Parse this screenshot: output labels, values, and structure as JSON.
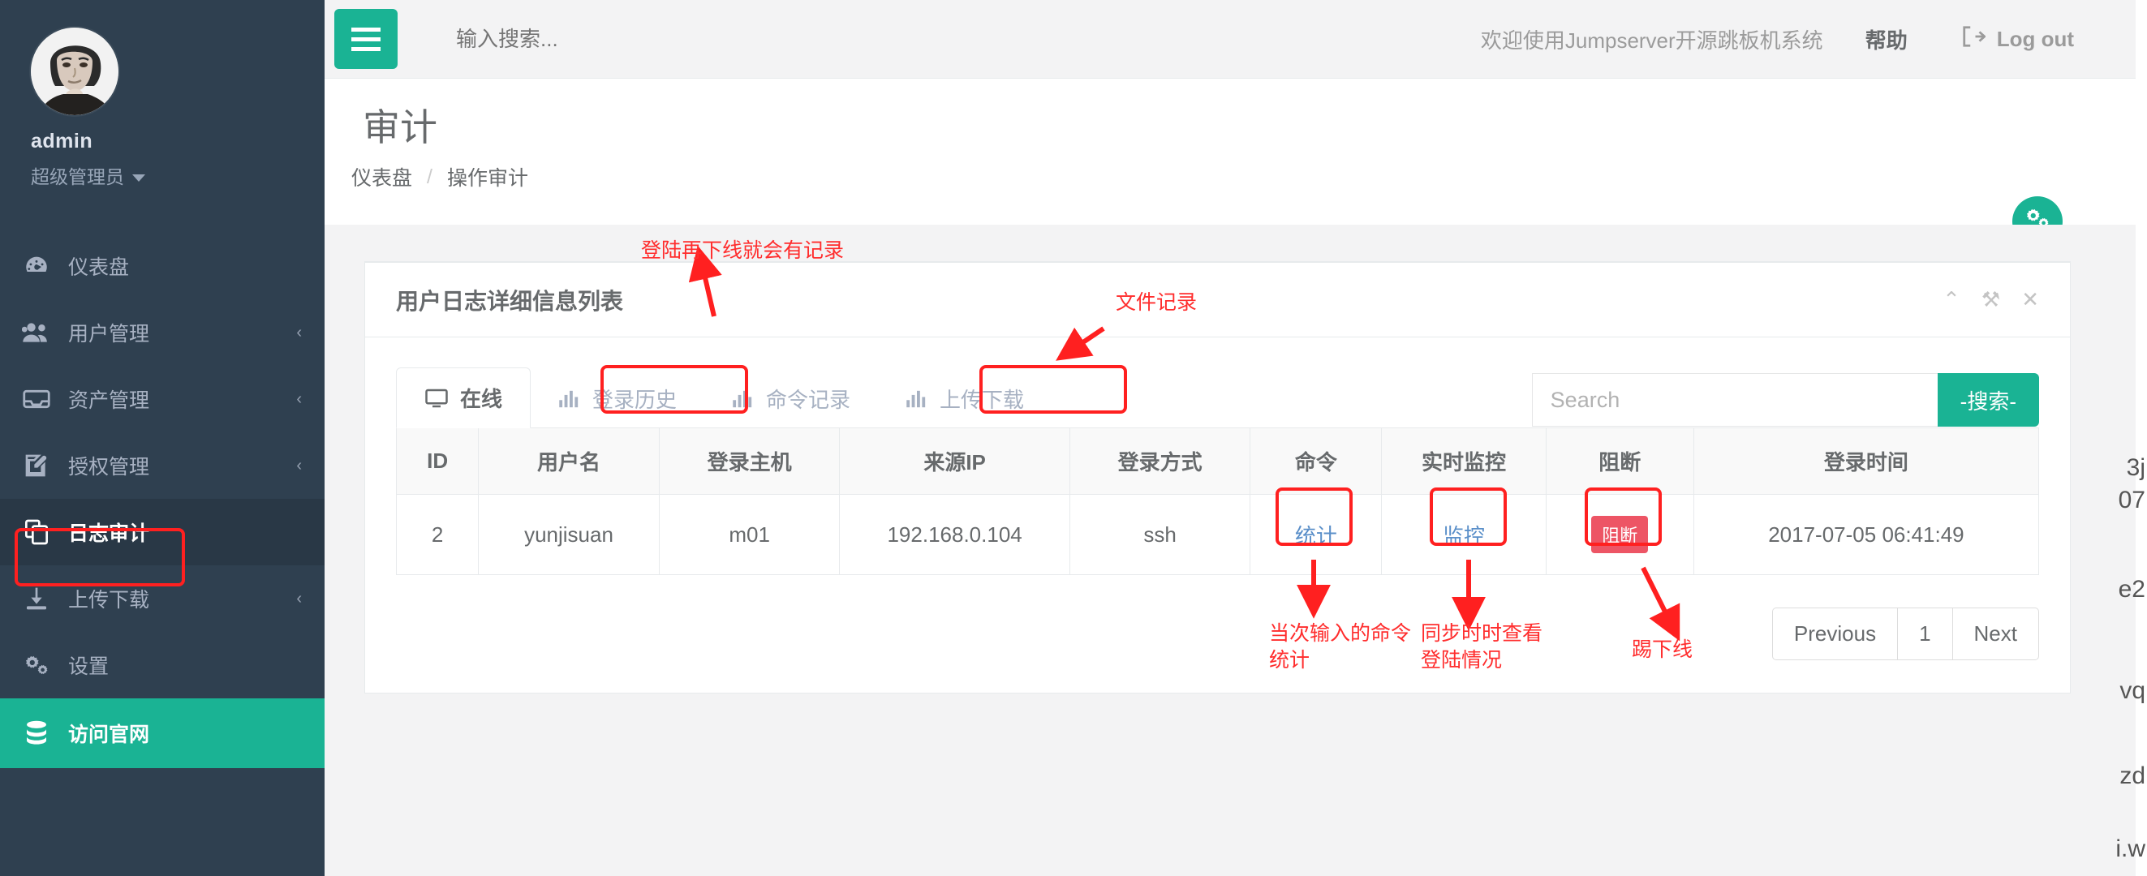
{
  "sidebar": {
    "user": {
      "name": "admin",
      "role": "超级管理员"
    },
    "items": [
      {
        "label": "仪表盘",
        "icon": "dashboard-icon",
        "arrow": "",
        "state": "normal"
      },
      {
        "label": "用户管理",
        "icon": "users-icon",
        "arrow": "‹",
        "state": "normal"
      },
      {
        "label": "资产管理",
        "icon": "inbox-icon",
        "arrow": "‹",
        "state": "normal"
      },
      {
        "label": "授权管理",
        "icon": "edit-icon",
        "arrow": "‹",
        "state": "normal"
      },
      {
        "label": "日志审计",
        "icon": "copy-icon",
        "arrow": "",
        "state": "active"
      },
      {
        "label": "上传下载",
        "icon": "download-icon",
        "arrow": "‹",
        "state": "normal"
      },
      {
        "label": "设置",
        "icon": "gears-icon",
        "arrow": "",
        "state": "normal"
      },
      {
        "label": "访问官网",
        "icon": "database-icon",
        "arrow": "",
        "state": "brand"
      }
    ]
  },
  "topbar": {
    "menu_toggle": "hamburger-icon",
    "search_placeholder": "输入搜索...",
    "welcome": "欢迎使用Jumpserver开源跳板机系统",
    "help": "帮助",
    "logout": "Log out"
  },
  "page": {
    "title": "审计",
    "breadcrumb": {
      "home": "仪表盘",
      "separator": "/",
      "current": "操作审计"
    }
  },
  "panel": {
    "title": "用户日志详细信息列表",
    "tools": {
      "collapse": "⌃",
      "settings": "⚒",
      "close": "✕"
    }
  },
  "tabs": [
    {
      "label": "在线",
      "icon": "monitor-icon",
      "active": true
    },
    {
      "label": "登录历史",
      "icon": "bar-chart-icon",
      "active": false
    },
    {
      "label": "命令记录",
      "icon": "bar-chart-icon",
      "active": false
    },
    {
      "label": "上传下载",
      "icon": "bar-chart-icon",
      "active": false
    }
  ],
  "search": {
    "placeholder": "Search",
    "value": "",
    "button": "-搜索-"
  },
  "table": {
    "columns": [
      "ID",
      "用户名",
      "登录主机",
      "来源IP",
      "登录方式",
      "命令",
      "实时监控",
      "阻断",
      "登录时间"
    ],
    "rows": [
      {
        "id": "2",
        "username": "yunjisuan",
        "host": "m01",
        "source_ip": "192.168.0.104",
        "login_type": "ssh",
        "command": "统计",
        "monitor": "监控",
        "block": "阻断",
        "login_time": "2017-07-05 06:41:49"
      }
    ]
  },
  "pagination": {
    "previous": "Previous",
    "page": "1",
    "next": "Next"
  },
  "annotations": [
    {
      "id": "note-login-history",
      "text": "登陆再下线就会有记录"
    },
    {
      "id": "note-file-record",
      "text": "文件记录"
    },
    {
      "id": "note-command-stats",
      "text": "当次输入的命令\n统计"
    },
    {
      "id": "note-realtime-monitor",
      "text": "同步时时查看\n登陆情况"
    },
    {
      "id": "note-kick-offline",
      "text": "踢下线"
    }
  ],
  "edge_fragments": [
    "3j",
    "07",
    "e2",
    "vq",
    "zd",
    "i.w"
  ],
  "colors": {
    "brand_green": "#1ab394",
    "sidebar_bg": "#2f4050",
    "sidebar_active": "#293846",
    "annotation_red": "#ff2d2d",
    "danger": "#ed5565",
    "link_blue": "#5a8fc9"
  }
}
